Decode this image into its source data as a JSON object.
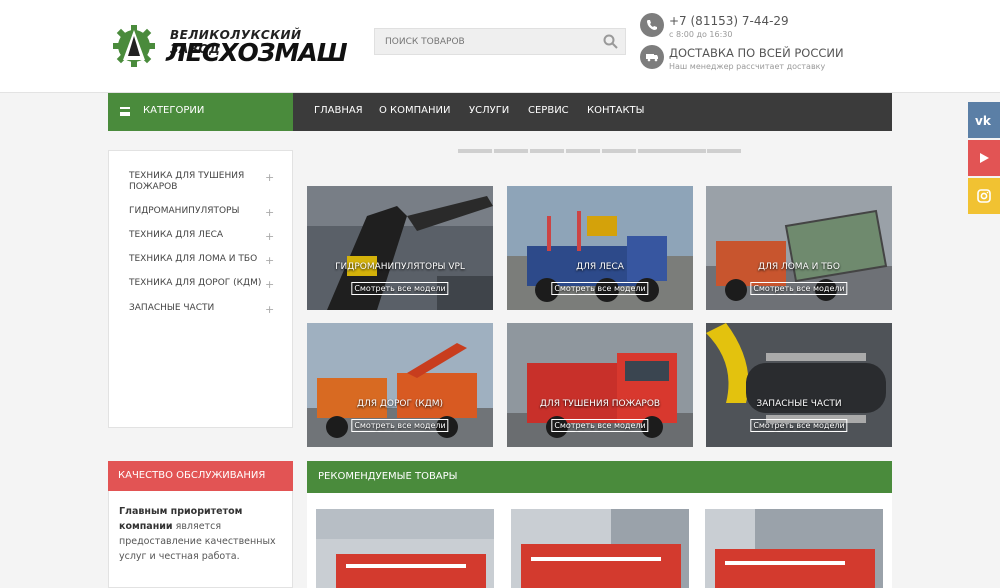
{
  "header": {
    "logo": {
      "line1": "ВЕЛИКОЛУКСКИЙ ЗАВОД",
      "line2": "ЛЕСХОЗМАШ"
    },
    "search": {
      "placeholder": "ПОИСК ТОВАРОВ"
    },
    "phone": {
      "number": "+7 (81153) 7-44-29",
      "hours": "с 8:00 до 16:30"
    },
    "delivery": {
      "title": "ДОСТАВКА ПО ВСЕЙ РОССИИ",
      "subtitle": "Наш менеджер рассчитает доставку"
    }
  },
  "nav": {
    "categories_label": "КАТЕГОРИИ",
    "items": [
      "ГЛАВНАЯ",
      "О КОМПАНИИ",
      "УСЛУГИ",
      "СЕРВИС",
      "КОНТАКТЫ"
    ]
  },
  "sidebar": {
    "categories": [
      "ТЕХНИКА ДЛЯ ТУШЕНИЯ ПОЖАРОВ",
      "ГИДРОМАНИПУЛЯТОРЫ",
      "ТЕХНИКА ДЛЯ ЛЕСА",
      "ТЕХНИКА ДЛЯ ЛОМА И ТБО",
      "ТЕХНИКА ДЛЯ ДОРОГ (КДМ)",
      "ЗАПАСНЫЕ ЧАСТИ"
    ]
  },
  "tiles": {
    "button_label": "Смотреть все модели",
    "labels": [
      "ГИДРОМАНИПУЛЯТОРЫ VPL",
      "ДЛЯ ЛЕСА",
      "ДЛЯ ЛОМА И ТБО",
      "ДЛЯ ДОРОГ (КДМ)",
      "ДЛЯ ТУШЕНИЯ ПОЖАРОВ",
      "ЗАПАСНЫЕ ЧАСТИ"
    ]
  },
  "quality": {
    "title": "КАЧЕСТВО ОБСЛУЖИВАНИЯ",
    "text_bold": "Главным приоритетом компании",
    "text_rest": " является предоставление качественных услуг и честная работа."
  },
  "recommended": {
    "title": "РЕКОМЕНДУЕМЫЕ ТОВАРЫ"
  },
  "social": [
    "vk",
    "youtube",
    "instagram"
  ],
  "colors": {
    "green": "#4a8b3c",
    "dark": "#3b3b3b",
    "red": "#e25454",
    "vk": "#5b7fa6",
    "youtube": "#e25454",
    "instagram": "#f1c232"
  }
}
